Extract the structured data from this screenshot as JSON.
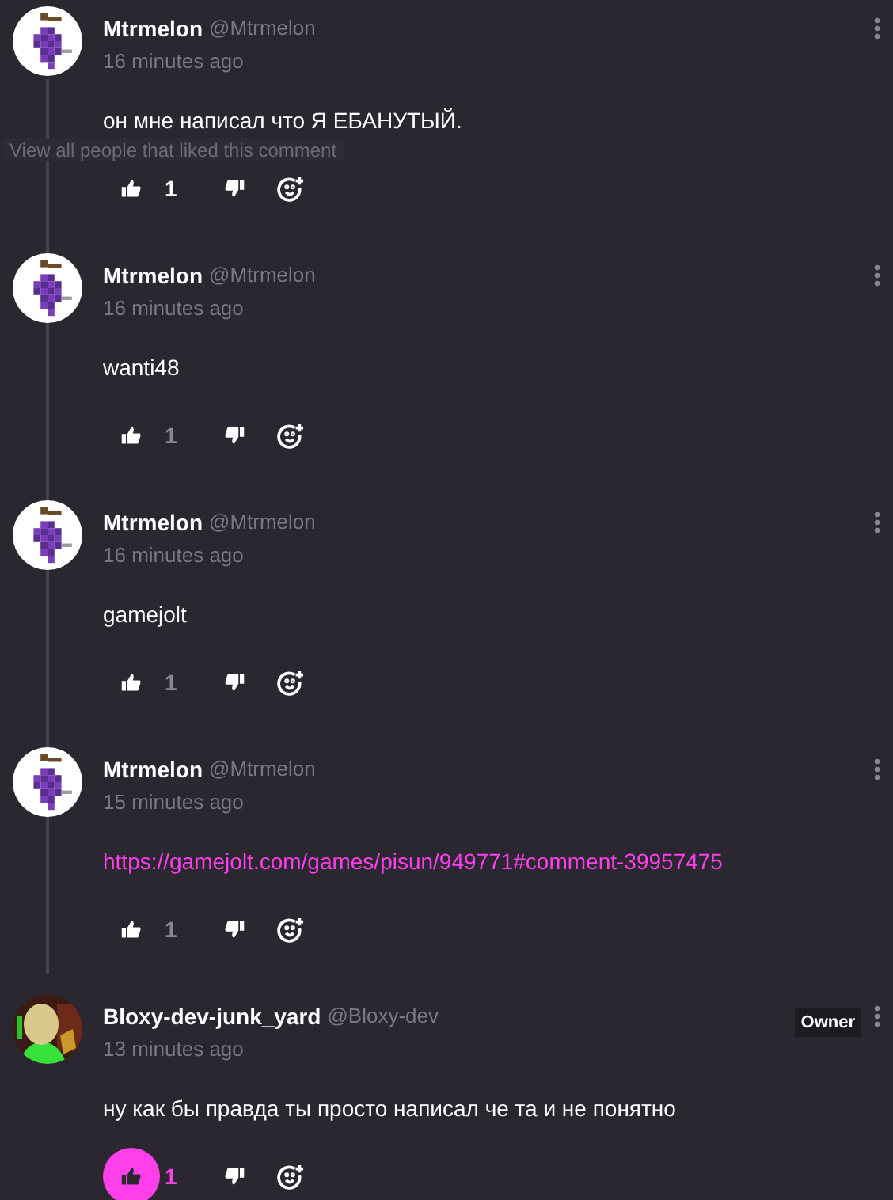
{
  "tooltip": {
    "text": "View all people that liked this comment"
  },
  "comments": [
    {
      "avatar": {
        "kind": "grapes"
      },
      "name": "Mtrmelon",
      "handle": "@Mtrmelon",
      "time": "16 minutes ago",
      "body": {
        "kind": "text",
        "text": "он мне написал что Я ЕБАНУТЫЙ."
      },
      "likes": "1",
      "liked": false,
      "hovered": true
    },
    {
      "avatar": {
        "kind": "grapes"
      },
      "name": "Mtrmelon",
      "handle": "@Mtrmelon",
      "time": "16 minutes ago",
      "body": {
        "kind": "text",
        "text": "wanti48"
      },
      "likes": "1",
      "liked": false,
      "hovered": false
    },
    {
      "avatar": {
        "kind": "grapes"
      },
      "name": "Mtrmelon",
      "handle": "@Mtrmelon",
      "time": "16 minutes ago",
      "body": {
        "kind": "text",
        "text": "gamejolt"
      },
      "likes": "1",
      "liked": false,
      "hovered": false
    },
    {
      "avatar": {
        "kind": "grapes"
      },
      "name": "Mtrmelon",
      "handle": "@Mtrmelon",
      "time": "15 minutes ago",
      "body": {
        "kind": "link",
        "text": "https://gamejolt.com/games/pisun/949771#comment-39957475"
      },
      "likes": "1",
      "liked": false,
      "hovered": false
    },
    {
      "name": "Bloxy-dev-junk_yard",
      "handle": "@Bloxy-dev",
      "badge": "Owner",
      "time": "13 minutes ago",
      "body": {
        "kind": "text",
        "text": "ну как бы правда ты просто написал че та и не понятно"
      },
      "likes": "1",
      "liked": true
    }
  ]
}
